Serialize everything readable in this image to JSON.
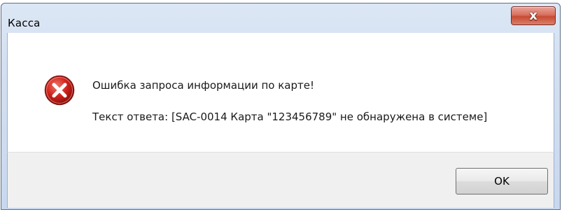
{
  "window": {
    "title": "Касса",
    "close_glyph": "x"
  },
  "message": {
    "icon": "error-icon",
    "line1": "Ошибка запроса информации по карте!",
    "line2": "Текст ответа: [SAC-0014 Карта \"123456789\" не обнаружена в системе]"
  },
  "buttons": {
    "ok_label": "OK"
  },
  "colors": {
    "error_red": "#c9211e",
    "close_button_red": "#c84a33",
    "frame_blue": "#d3e0f1"
  }
}
